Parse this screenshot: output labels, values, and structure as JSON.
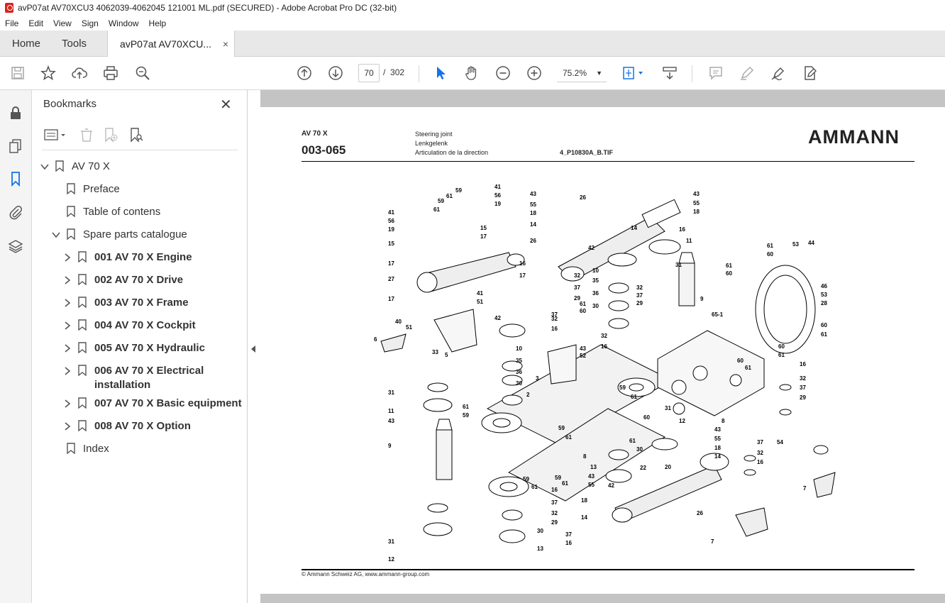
{
  "window": {
    "title": "avP07at AV70XCU3 4062039-4062045 121001 ML.pdf (SECURED) - Adobe Acrobat Pro DC (32-bit)"
  },
  "menu": [
    "File",
    "Edit",
    "View",
    "Sign",
    "Window",
    "Help"
  ],
  "tabs": {
    "home": "Home",
    "tools": "Tools",
    "document": "avP07at AV70XCU...",
    "close": "×"
  },
  "toolbar": {
    "current_page": "70",
    "page_separator": "/",
    "total_pages": "302",
    "zoom": "75.2%"
  },
  "bookmarks": {
    "title": "Bookmarks",
    "close": "✕",
    "items": [
      {
        "label": "AV 70 X",
        "bold": false
      },
      {
        "label": "Preface",
        "bold": false
      },
      {
        "label": "Table of contens",
        "bold": false
      },
      {
        "label": "Spare parts catalogue",
        "bold": false
      },
      {
        "label": "001 AV 70 X Engine",
        "bold": true
      },
      {
        "label": "002 AV 70 X Drive",
        "bold": true
      },
      {
        "label": "003 AV 70 X Frame",
        "bold": true
      },
      {
        "label": "004 AV 70 X Cockpit",
        "bold": true
      },
      {
        "label": "005 AV 70 X Hydraulic",
        "bold": true
      },
      {
        "label": "006 AV 70 X Electrical",
        "label2": "installation",
        "bold": true
      },
      {
        "label": "007 AV 70 X Basic equipment",
        "bold": true
      },
      {
        "label": "008 AV 70 X Option",
        "bold": true
      },
      {
        "label": "Index",
        "bold": false
      }
    ]
  },
  "page": {
    "model": "AV 70 X",
    "code": "003-065",
    "desc_en": "Steering joint",
    "desc_de": "Lenkgelenk",
    "desc_fr": "Articulation de la direction",
    "file": "4_P10830A_B.TIF",
    "logo": "AMMANN",
    "footer": "© Ammann Schweiz AG, www.ammann-group.com",
    "ref": "65-1"
  },
  "colors": {
    "accent_blue": "#1473e6",
    "acrobat_red": "#d7261e"
  }
}
